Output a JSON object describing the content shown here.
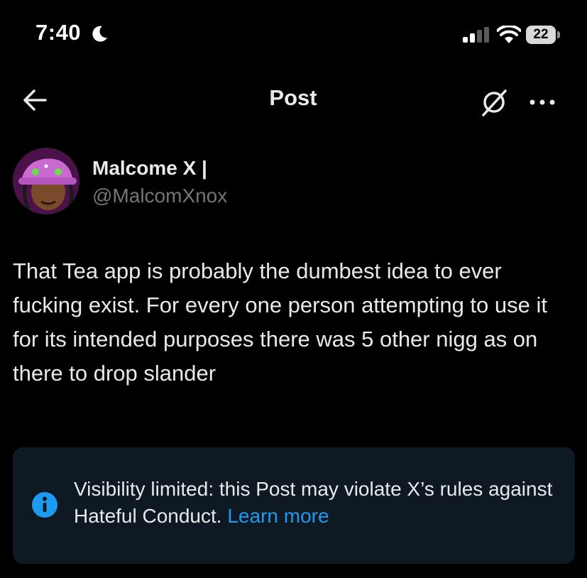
{
  "status_bar": {
    "time": "7:40",
    "battery_level": "22",
    "icons": [
      "moon-icon",
      "signal-icon",
      "wifi-icon",
      "battery-icon"
    ]
  },
  "header": {
    "title": "Post",
    "icons": [
      "back-arrow-icon",
      "grok-icon",
      "more-icon"
    ]
  },
  "post": {
    "author": {
      "display_name": "Malcome X |",
      "handle": "@MalcomXnox"
    },
    "text": "That Tea app is probably the dumbest idea to ever fucking exist. For every one person attempting to use it for its intended purposes there was 5 other nigg as on there to drop slander"
  },
  "notice": {
    "text": "Visibility limited: this Post may violate X’s rules against Hateful Conduct.",
    "link_label": "Learn more",
    "icon": "info-icon"
  },
  "colors": {
    "background": "#000000",
    "text": "#e7e9ea",
    "secondary_text": "#71767b",
    "link": "#1d9bf0",
    "notice_background": "#0f1923"
  }
}
